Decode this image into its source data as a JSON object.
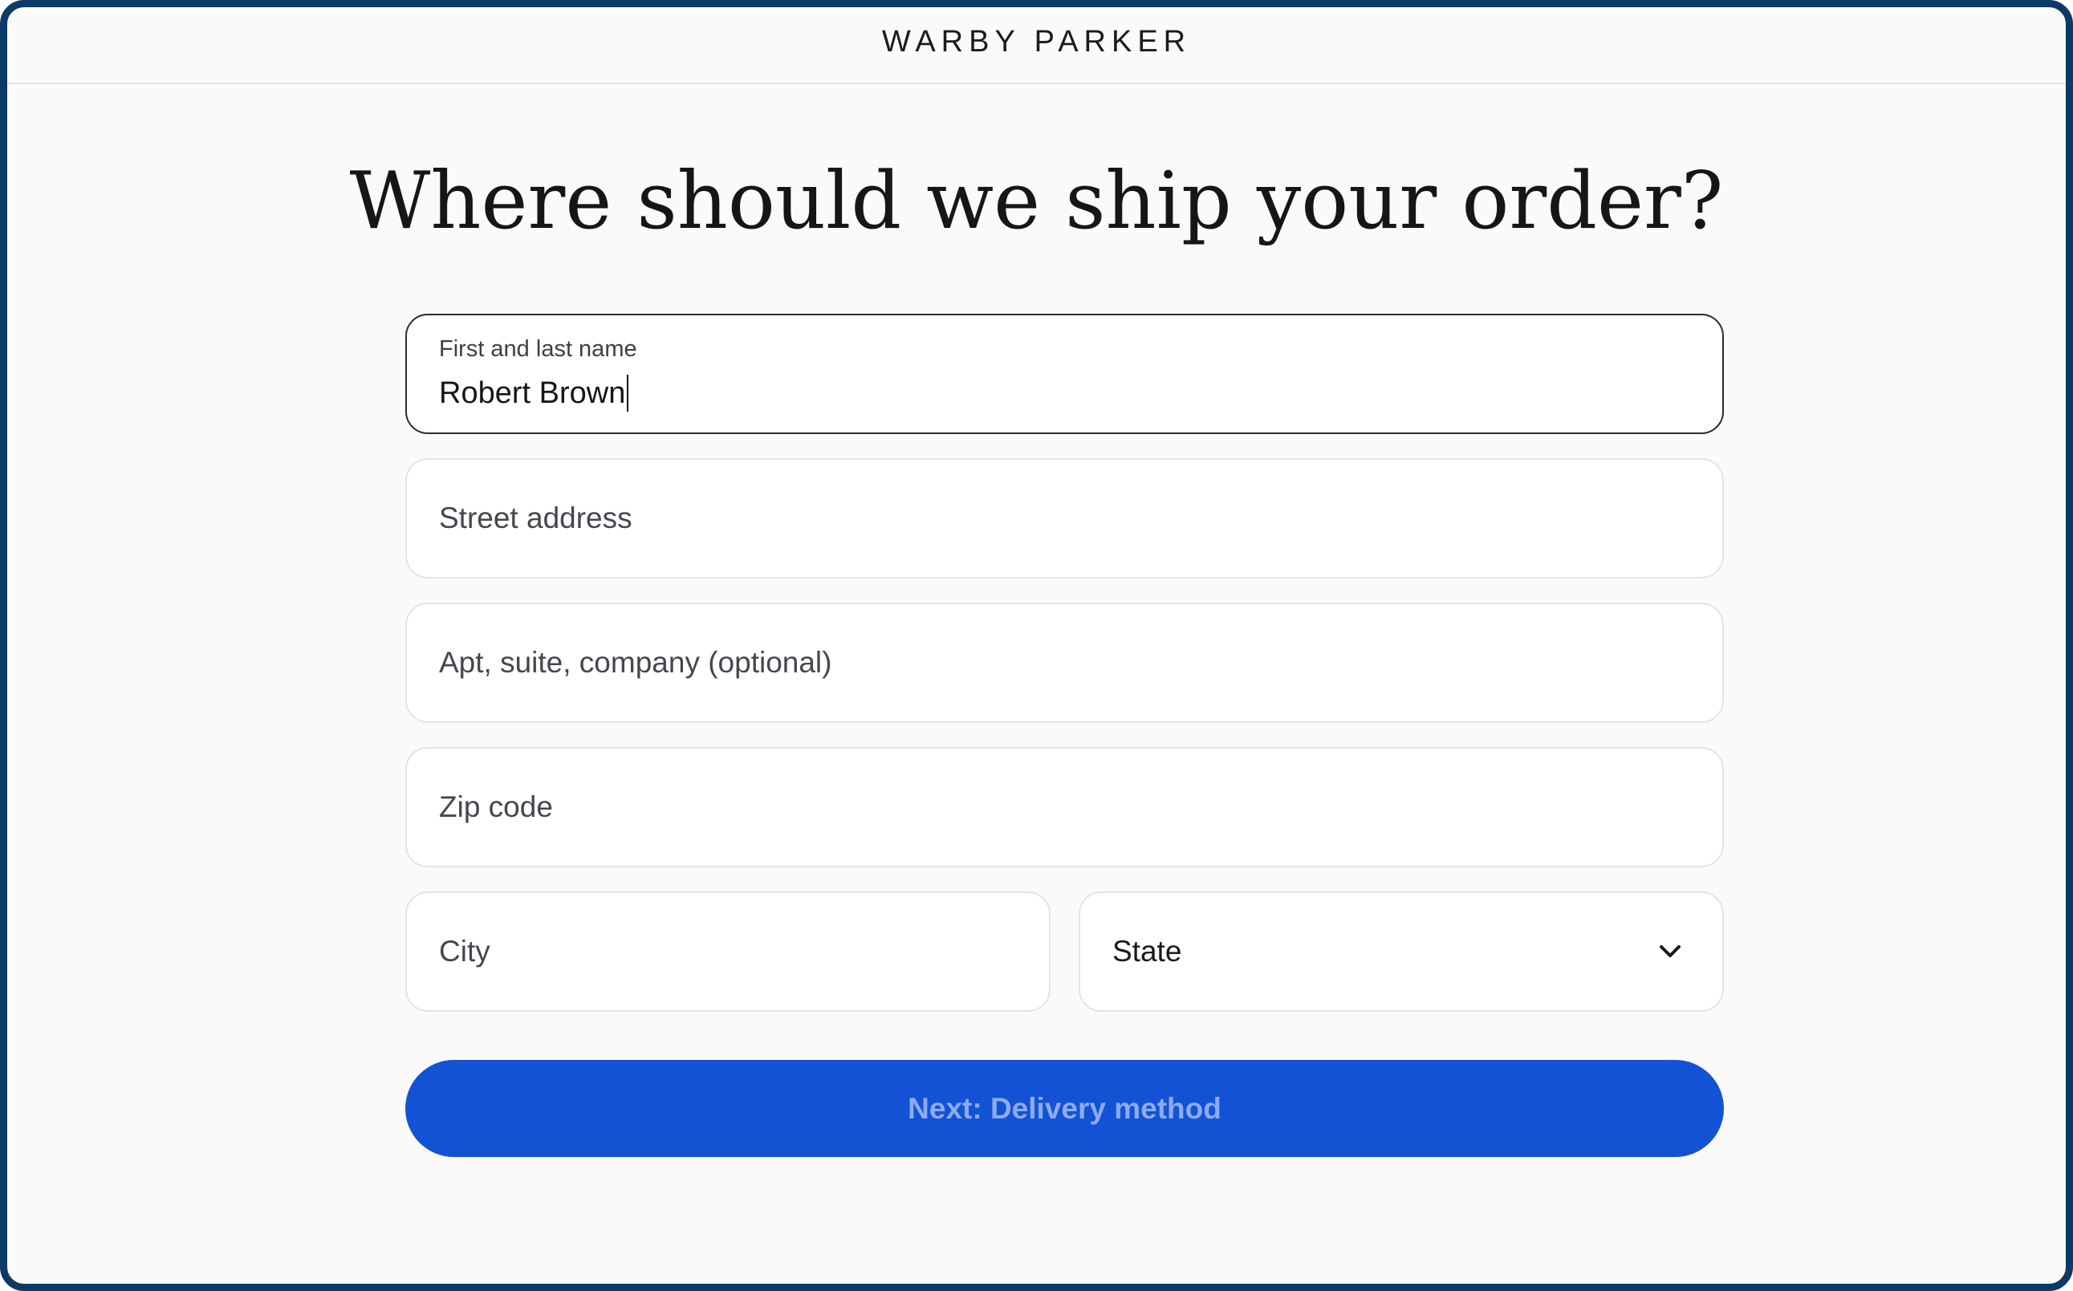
{
  "brand": {
    "logo_text": "WARBY PARKER"
  },
  "heading": "Where should we ship your order?",
  "form": {
    "name": {
      "label": "First and last name",
      "value": "Robert Brown"
    },
    "street": {
      "placeholder": "Street address"
    },
    "apt": {
      "placeholder": "Apt, suite, company (optional)"
    },
    "zip": {
      "placeholder": "Zip code"
    },
    "city": {
      "placeholder": "City"
    },
    "state": {
      "selected": "State"
    }
  },
  "next_button_label": "Next: Delivery method",
  "colors": {
    "frame_border": "#0b3a66",
    "background": "#fbfaf8",
    "button": "#1352d4",
    "button_text": "#8eaaf0"
  }
}
